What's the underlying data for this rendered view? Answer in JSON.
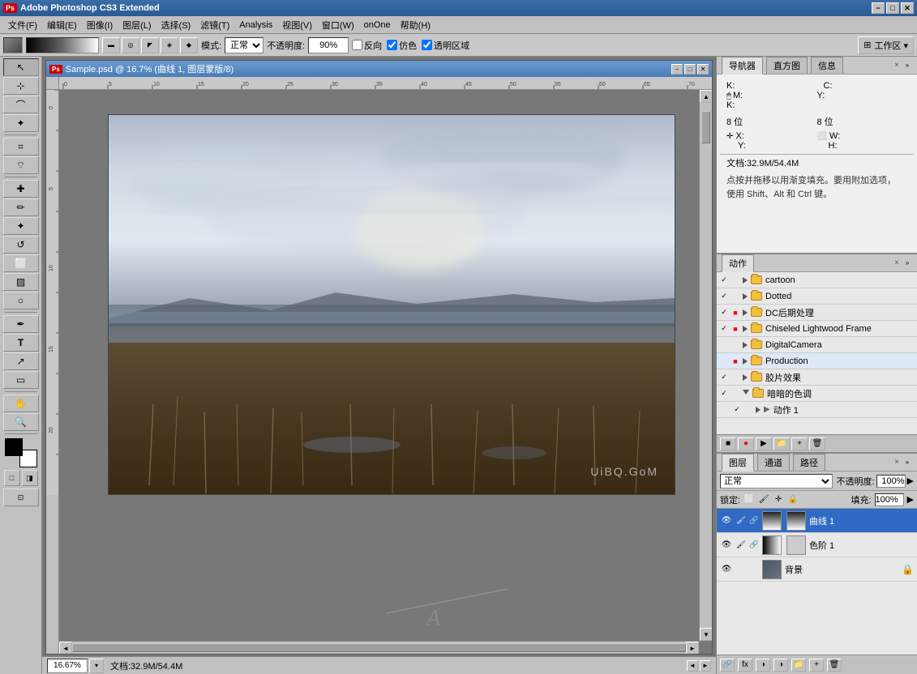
{
  "titlebar": {
    "app_name": "Adobe Photoshop CS3 Extended",
    "ps_icon": "Ps",
    "minimize": "−",
    "maximize": "□",
    "close": "✕"
  },
  "menubar": {
    "items": [
      {
        "label": "文件(F)"
      },
      {
        "label": "编辑(E)"
      },
      {
        "label": "图像(I)"
      },
      {
        "label": "图层(L)"
      },
      {
        "label": "选择(S)"
      },
      {
        "label": "滤镜(T)"
      },
      {
        "label": "Analysis"
      },
      {
        "label": "视图(V)"
      },
      {
        "label": "窗口(W)"
      },
      {
        "label": "onOne"
      },
      {
        "label": "帮助(H)"
      }
    ]
  },
  "optionsbar": {
    "mode_label": "模式:",
    "mode_value": "正常",
    "opacity_label": "不透明度:",
    "opacity_value": "90%",
    "reverse_label": "反向",
    "dither_label": "仿色",
    "transparency_label": "透明区域",
    "workspace_label": "工作区 ▾"
  },
  "document": {
    "title": "Sample.psd @ 16.7% (曲线 1, 图层蒙版/8)",
    "ps_icon": "Ps",
    "zoom": "16.67%",
    "doc_size": "文档:32.9M/54.4M"
  },
  "ruler": {
    "ticks": [
      0,
      5,
      10,
      15,
      20,
      25,
      30,
      35,
      40,
      45
    ]
  },
  "navigator_panel": {
    "tabs": [
      "导航器",
      "直方图",
      "信息"
    ],
    "active_tab": "导航器",
    "close_btn": "×",
    "info_K_label": "K:",
    "info_C_label": "C:",
    "info_mouse_label": "🖱",
    "info_M_label": "M:",
    "info_Y_label": "Y:",
    "info_K2_label": "K:",
    "info_8bit": "8 位",
    "info_X_label": "X:",
    "info_Y2_label": "Y:",
    "info_W_label": "W:",
    "info_H_label": "H:",
    "doc_size": "文档:32.9M/54.4M",
    "hint_text": "点按并拖移以用渐变填充。要用附加选项，\n使用 Shift、Alt 和 Ctrl 键。"
  },
  "actions_panel": {
    "title": "动作",
    "close_btn": "×",
    "expand_btn": "»",
    "actions": [
      {
        "checked": true,
        "red": false,
        "expanded": false,
        "type": "folder",
        "name": "cartoon"
      },
      {
        "checked": true,
        "red": false,
        "expanded": false,
        "type": "folder",
        "name": "Dotted"
      },
      {
        "checked": true,
        "red": true,
        "expanded": false,
        "type": "folder",
        "name": "DC后期处理"
      },
      {
        "checked": true,
        "red": true,
        "expanded": false,
        "type": "folder",
        "name": "Chiseled Lightwood Frame"
      },
      {
        "checked": false,
        "red": false,
        "expanded": false,
        "type": "folder",
        "name": "DigitalCamera"
      },
      {
        "checked": false,
        "red": true,
        "expanded": false,
        "type": "folder",
        "name": "Production",
        "selected": true
      },
      {
        "checked": true,
        "red": false,
        "expanded": false,
        "type": "folder",
        "name": "胶片效果"
      },
      {
        "checked": true,
        "red": false,
        "expanded": true,
        "type": "folder",
        "name": "暗暗的色调"
      },
      {
        "checked": true,
        "red": false,
        "expanded": true,
        "type": "action",
        "name": "动作 1"
      }
    ],
    "toolbar_btns": [
      "■",
      "●",
      "▶",
      "■",
      "↺",
      "🗑"
    ]
  },
  "layers_panel": {
    "tabs": [
      "图层",
      "通道",
      "路径"
    ],
    "active_tab": "图层",
    "close_btn": "×",
    "blend_mode": "正常",
    "opacity_label": "不透明度:",
    "opacity_value": "100%",
    "lock_label": "锁定:",
    "fill_label": "填充:",
    "fill_value": "100%",
    "layers": [
      {
        "visible": true,
        "name": "曲线 1",
        "type": "curve",
        "selected": true,
        "has_mask": true
      },
      {
        "visible": true,
        "name": "色阶 1",
        "type": "levels",
        "selected": false,
        "has_mask": true
      },
      {
        "visible": true,
        "name": "背景",
        "type": "bg",
        "selected": false,
        "has_mask": false,
        "locked": true
      }
    ],
    "bottom_btns": [
      "⬆",
      "fx",
      "◑",
      "🗒",
      "📁",
      "🗑"
    ]
  },
  "statusbar": {
    "zoom": "16.67%",
    "doc_size": "文档:32.9M/54.4M"
  },
  "toolbar": {
    "tools": [
      "↖",
      "⊹",
      "✂",
      "✏",
      "🔲",
      "◯",
      "🖊",
      "🧹",
      "▨",
      "🔍",
      "T",
      "✒",
      "🖐",
      "🔍+",
      "◼"
    ]
  },
  "colors": {
    "accent_blue": "#316ac5",
    "panel_bg": "#c8c8c8",
    "titlebar_blue": "#4a7cb5",
    "action_red_bg": "#cc0000"
  },
  "watermark": "UiBQ.GoM"
}
